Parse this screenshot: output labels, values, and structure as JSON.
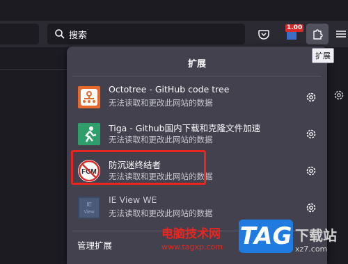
{
  "toolbar": {
    "search_placeholder": "搜索",
    "badge_text": "1.00",
    "tooltip": "扩展"
  },
  "panel": {
    "title": "扩展",
    "items": [
      {
        "name": "Octotree - GitHub code tree",
        "desc": "无法读取和更改此网站的数据",
        "icon": "octotree-icon"
      },
      {
        "name": "Tiga - Github国内下载和克隆文件加速",
        "desc": "无法读取和更改此网站的数据",
        "icon": "tiga-icon"
      },
      {
        "name": "防沉迷终结者",
        "desc": "无法读取和更改此网站的数据",
        "icon": "fcm-icon"
      },
      {
        "name": "IE View WE",
        "desc": "无法读取和更改此网站的数据",
        "icon": "ieview-icon"
      }
    ],
    "manage_label": "管理扩展",
    "fcm_icon_text": "FCM"
  },
  "watermark": {
    "text": "电脑技术网",
    "url": "www.tagxp.com",
    "logo": "TAG",
    "side": "下载站",
    "side2": "xz7.com"
  },
  "colors": {
    "panel_bg": "#42414d",
    "highlight": "#e8261f",
    "accent_orange": "#e8692c",
    "accent_green": "#2e9e6a"
  }
}
